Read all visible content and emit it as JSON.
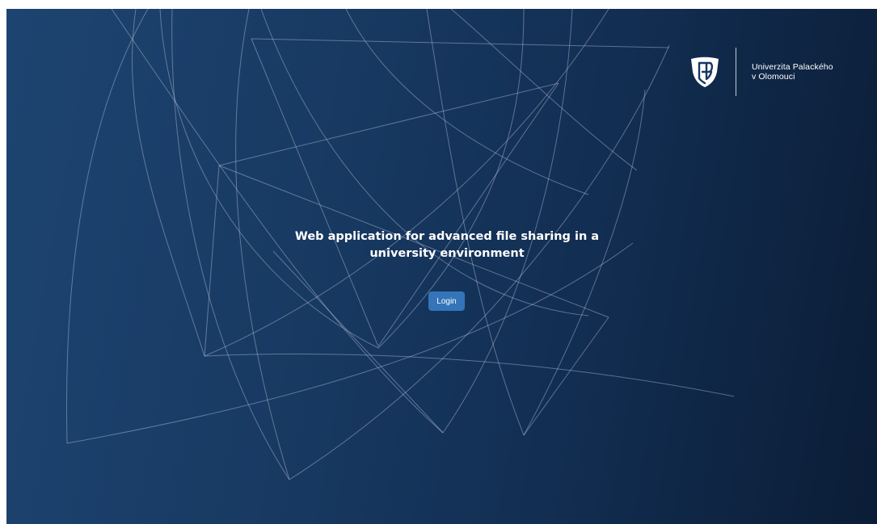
{
  "logo": {
    "name_line1": "Univerzita Palackého",
    "name_line2": "v Olomouci",
    "emblem_icon": "university-shield-icon"
  },
  "hero": {
    "title": "Web application for advanced file sharing in a university environment"
  },
  "actions": {
    "login_label": "Login"
  },
  "colors": {
    "background_start": "#1d4470",
    "background_end": "#0b1d36",
    "button": "#3474b9",
    "text": "#ffffff"
  }
}
